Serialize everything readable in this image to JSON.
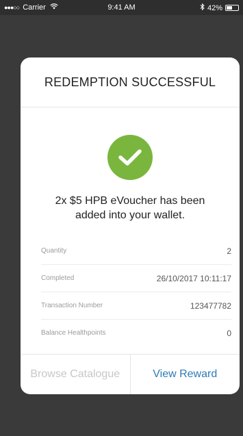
{
  "status_bar": {
    "signal": "●●●○○",
    "carrier": "Carrier",
    "time": "9:41 AM",
    "battery": "42%"
  },
  "card": {
    "title": "REDEMPTION SUCCESSFUL",
    "message": "2x $5 HPB eVoucher has been added into your wallet.",
    "success_color": "#7ab63e",
    "details": [
      {
        "label": "Quantity",
        "value": "2"
      },
      {
        "label": "Completed",
        "value": "26/10/2017 10:11:17"
      },
      {
        "label": "Transaction Number",
        "value": "123477782"
      },
      {
        "label": "Balance Healthpoints",
        "value": "0"
      }
    ],
    "actions": {
      "browse_label": "Browse Catalogue",
      "view_label": "View Reward",
      "link_color": "#2d7ab8"
    }
  }
}
